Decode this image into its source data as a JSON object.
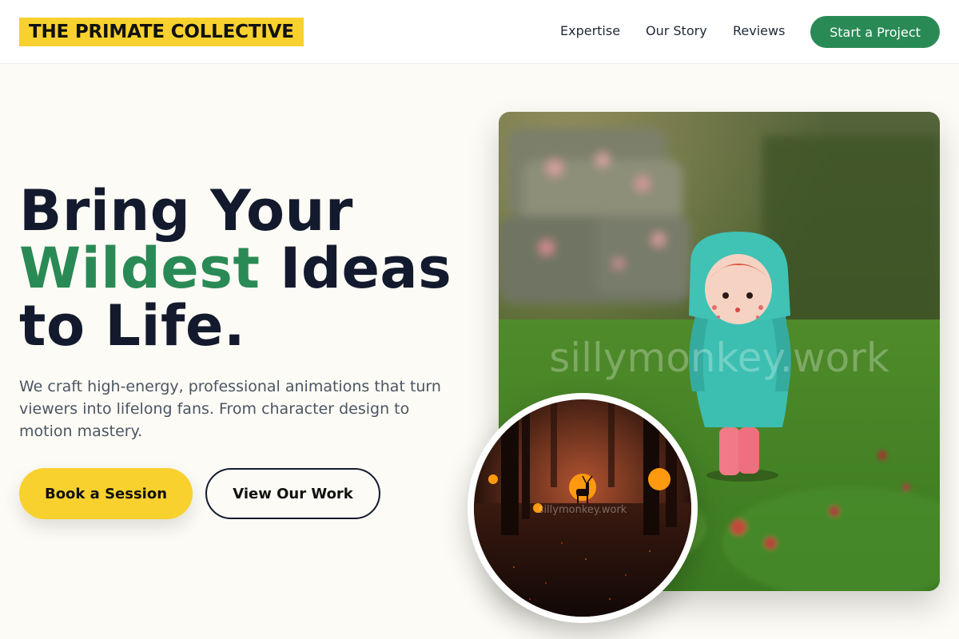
{
  "nav": {
    "logo": "THE PRIMATE COLLECTIVE",
    "links": [
      "Expertise",
      "Our Story",
      "Reviews"
    ],
    "cta": "Start a Project"
  },
  "hero": {
    "title_line1": "Bring Your",
    "title_accent": "Wildest",
    "title_line2_rest": " Ideas",
    "title_line3": "to Life.",
    "subtitle": "We craft high-energy, professional animations that turn viewers into lifelong fans. From character design to motion mastery.",
    "primary_button": "Book a Session",
    "secondary_button": "View Our Work"
  },
  "images": {
    "main_watermark": "sillymonkey.work",
    "circle_watermark": "sillymonkey.work"
  },
  "colors": {
    "accent_green": "#2a8a55",
    "accent_yellow": "#f8d12f",
    "ink": "#131a2e",
    "background": "#fcfbf5"
  }
}
